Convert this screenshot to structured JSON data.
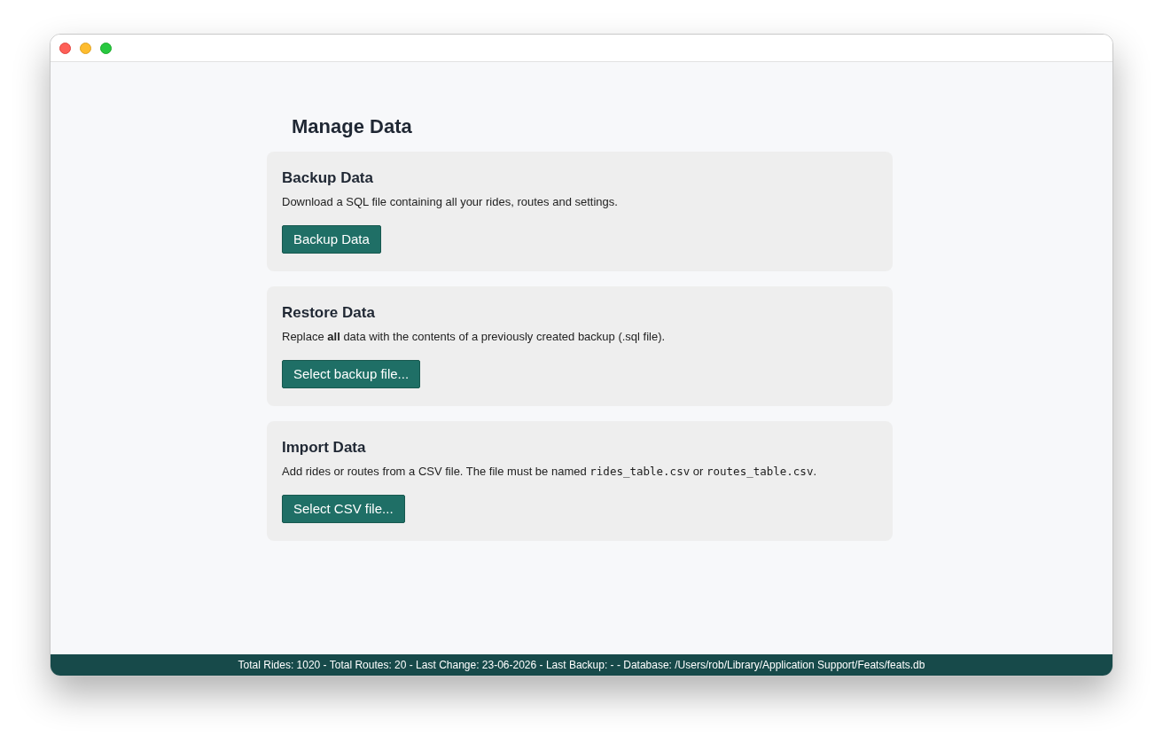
{
  "page": {
    "title": "Manage Data"
  },
  "sections": [
    {
      "heading": "Backup Data",
      "description": [
        {
          "kind": "text",
          "text": "Download a SQL file containing all your rides, routes and settings."
        }
      ],
      "button": "Backup Data"
    },
    {
      "heading": "Restore Data",
      "description": [
        {
          "kind": "text",
          "text": "Replace **all** data with the contents of a previously created backup (.sql file)."
        }
      ],
      "button": "Select backup file..."
    },
    {
      "heading": "Import Data",
      "description": [
        {
          "kind": "text",
          "text": "Add rides or routes from a CSV file. The file must be named "
        },
        {
          "kind": "code",
          "text": "rides_table.csv"
        },
        {
          "kind": "text",
          "text": " or "
        },
        {
          "kind": "code",
          "text": "routes_table.csv"
        },
        {
          "kind": "text",
          "text": "."
        }
      ],
      "button": "Select CSV file..."
    }
  ],
  "status_bar": "Total Rides: 1020 - Total Routes: 20 - Last Change: 23-06-2026 - Last Backup: - - Database: /Users/rob/Library/Application Support/Feats/feats.db"
}
